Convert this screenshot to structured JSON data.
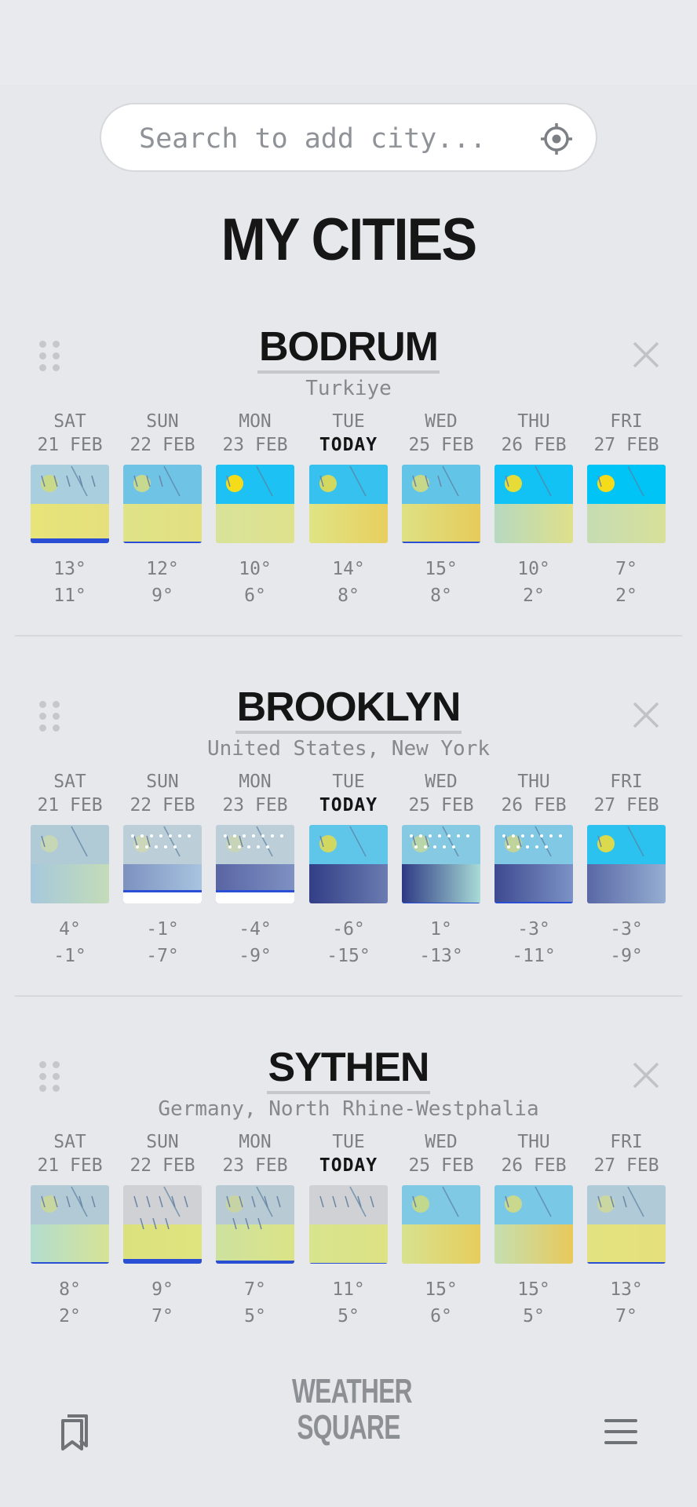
{
  "search": {
    "placeholder": "Search to add city...",
    "value": ""
  },
  "page_title": "MY CITIES",
  "brand": {
    "line1": "WEATHER",
    "line2": "SQUARE"
  },
  "colors": {
    "sky_clear": "#00c4f6",
    "sky_partly": "#5fc6ea",
    "sky_cloudy": "#b4ccd8",
    "sky_grey": "#cfd1d4",
    "sun": "#f5dc1a",
    "rain_bar": "#2a4fd4"
  },
  "cities": [
    {
      "name": "BODRUM",
      "region": "Turkiye",
      "days": [
        {
          "day": "SAT",
          "date": "21 FEB",
          "hi": "13°",
          "lo": "11°",
          "sky": "#a9cfdf",
          "ground": "#e7e47a",
          "ground2": "#e5e07c",
          "sun": "#c9d98a",
          "rain": 5,
          "bar": 6
        },
        {
          "day": "SUN",
          "date": "22 FEB",
          "hi": "12°",
          "lo": "9°",
          "sky": "#6fc4e6",
          "ground": "#dfe389",
          "ground2": "#e3e080",
          "sun": "#c7d98f",
          "rain": 3,
          "bar": 2
        },
        {
          "day": "MON",
          "date": "23 FEB",
          "hi": "10°",
          "lo": "6°",
          "sky": "#1ec1f3",
          "ground": "#d8e39a",
          "ground2": "#dfe28c",
          "sun": "#f5dc1a",
          "rain": 1,
          "bar": 0
        },
        {
          "day": "TUE",
          "date": "TODAY",
          "today": true,
          "hi": "14°",
          "lo": "8°",
          "sky": "#36c1ee",
          "ground": "#dfe485",
          "ground2": "#e8cf5e",
          "sun": "#d3d85e",
          "rain": 1,
          "bar": 0
        },
        {
          "day": "WED",
          "date": "25 FEB",
          "hi": "15°",
          "lo": "8°",
          "sky": "#62c5e8",
          "ground": "#dde184",
          "ground2": "#e6cb5a",
          "sun": "#c8d889",
          "rain": 3,
          "bar": 2
        },
        {
          "day": "THU",
          "date": "26 FEB",
          "hi": "10°",
          "lo": "2°",
          "sky": "#12c2f4",
          "ground": "#b6d9c0",
          "ground2": "#dfe08a",
          "sun": "#e6db37",
          "rain": 1,
          "bar": 0
        },
        {
          "day": "FRI",
          "date": "27 FEB",
          "hi": "7°",
          "lo": "2°",
          "sky": "#00c4f6",
          "ground": "#c6dcb4",
          "ground2": "#d8e099",
          "sun": "#f5dc1a",
          "rain": 1,
          "bar": 0
        }
      ]
    },
    {
      "name": "BROOKLYN",
      "region": "United States, New York",
      "days": [
        {
          "day": "SAT",
          "date": "21 FEB",
          "hi": "4°",
          "lo": "-1°",
          "sky": "#b0cad6",
          "ground": "#a6c8dc",
          "ground2": "#c4dcb8",
          "sun": "#c5d7b4",
          "rain": 1,
          "bar": 0
        },
        {
          "day": "SUN",
          "date": "22 FEB",
          "hi": "-1°",
          "lo": "-7°",
          "sky": "#bccfd8",
          "ground": "#7d91bf",
          "ground2": "#a8c4e0",
          "sun": "#ccd6b8",
          "rain": 2,
          "snow": true,
          "bar": 4,
          "white": true
        },
        {
          "day": "MON",
          "date": "23 FEB",
          "hi": "-4°",
          "lo": "-9°",
          "sky": "#bccfd8",
          "ground": "#5965a4",
          "ground2": "#7f91c2",
          "sun": "#c8d4b8",
          "rain": 2,
          "snow": true,
          "bar": 4,
          "white": true
        },
        {
          "day": "TUE",
          "date": "TODAY",
          "today": true,
          "hi": "-6°",
          "lo": "-15°",
          "sky": "#5fc6ea",
          "ground": "#323e86",
          "ground2": "#6a7cb2",
          "sun": "#d1d861",
          "rain": 1,
          "bar": 0
        },
        {
          "day": "WED",
          "date": "25 FEB",
          "hi": "1°",
          "lo": "-13°",
          "sky": "#86c9e2",
          "ground": "#2e3a84",
          "ground2": "#a8dbd6",
          "sun": "#b8d6a8",
          "rain": 2,
          "snow": true,
          "bar": 1
        },
        {
          "day": "THU",
          "date": "26 FEB",
          "hi": "-3°",
          "lo": "-11°",
          "sky": "#80c8e4",
          "ground": "#3e4a90",
          "ground2": "#7c93c6",
          "sun": "#bfd39a",
          "rain": 2,
          "snow": true,
          "bar": 2
        },
        {
          "day": "FRI",
          "date": "27 FEB",
          "hi": "-3°",
          "lo": "-9°",
          "sky": "#2cc2f0",
          "ground": "#5a68a6",
          "ground2": "#95aed2",
          "sun": "#dbd94c",
          "rain": 1,
          "bar": 0
        }
      ]
    },
    {
      "name": "SYTHEN",
      "region": "Germany, North Rhine-Westphalia",
      "days": [
        {
          "day": "SAT",
          "date": "21 FEB",
          "hi": "8°",
          "lo": "2°",
          "sky": "#b2cad6",
          "ground": "#b3ddd0",
          "ground2": "#d6e394",
          "sun": "#c8d6a0",
          "rain": 5,
          "bar": 2
        },
        {
          "day": "SUN",
          "date": "22 FEB",
          "hi": "9°",
          "lo": "7°",
          "sky": "#cfd1d4",
          "ground": "#dbe17e",
          "ground2": "#e0e47e",
          "sun": "#cfd1d4",
          "rain": 8,
          "bar": 6
        },
        {
          "day": "MON",
          "date": "23 FEB",
          "hi": "7°",
          "lo": "5°",
          "sky": "#b8cbd4",
          "ground": "#cde29f",
          "ground2": "#dbe386",
          "sun": "#c8d3a4",
          "rain": 8,
          "bar": 4
        },
        {
          "day": "TUE",
          "date": "TODAY",
          "today": true,
          "hi": "11°",
          "lo": "5°",
          "sky": "#cfd1d4",
          "ground": "#d8e48e",
          "ground2": "#dde283",
          "sun": "#cfd1d4",
          "rain": 5,
          "bar": 1
        },
        {
          "day": "WED",
          "date": "25 FEB",
          "hi": "15°",
          "lo": "6°",
          "sky": "#7fc9e4",
          "ground": "#d7e28f",
          "ground2": "#e6cd5c",
          "sun": "#c2d88d",
          "rain": 1,
          "bar": 0
        },
        {
          "day": "THU",
          "date": "26 FEB",
          "hi": "15°",
          "lo": "5°",
          "sky": "#79c8e6",
          "ground": "#c5dfb0",
          "ground2": "#e8c95a",
          "sun": "#c9d88c",
          "rain": 1,
          "bar": 0
        },
        {
          "day": "FRI",
          "date": "27 FEB",
          "hi": "13°",
          "lo": "7°",
          "sky": "#b0cbd7",
          "ground": "#e2e380",
          "ground2": "#e5e07c",
          "sun": "#cad7a0",
          "rain": 3,
          "bar": 2
        }
      ]
    }
  ]
}
